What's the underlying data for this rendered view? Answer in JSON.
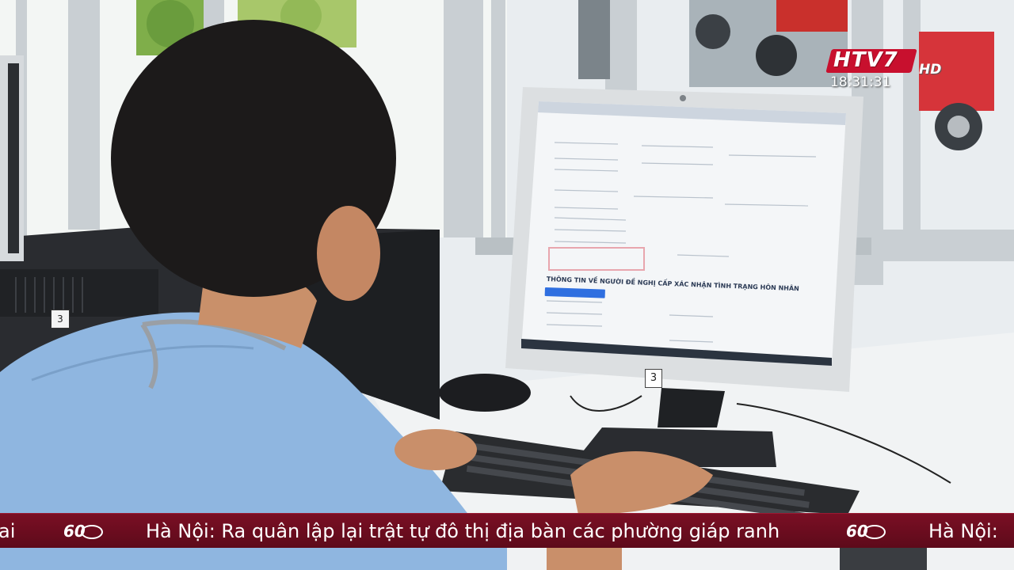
{
  "broadcast": {
    "channel_logo": "HTV7",
    "hd_badge": "HD",
    "clock": "18:31:31"
  },
  "ticker": {
    "left_fragment": "ai",
    "headline": "Hà Nội: Ra quân lập lại trật tự đô thị địa bàn các phường giáp ranh",
    "right_fragment": "Hà Nội:",
    "logo_label": "60"
  },
  "monitor": {
    "section_heading": "THÔNG TIN VỀ NGƯỜI ĐỀ NGHỊ CẤP XÁC NHẬN TÌNH TRẠNG HÔN NHÂN",
    "desk_number": "3"
  },
  "computer": {
    "tower_number": "3"
  },
  "colors": {
    "ticker_bg": "#6e0d20",
    "logo_red": "#c8102e",
    "shirt_blue": "#8fb6e0",
    "form_button": "#2f6fe0"
  }
}
